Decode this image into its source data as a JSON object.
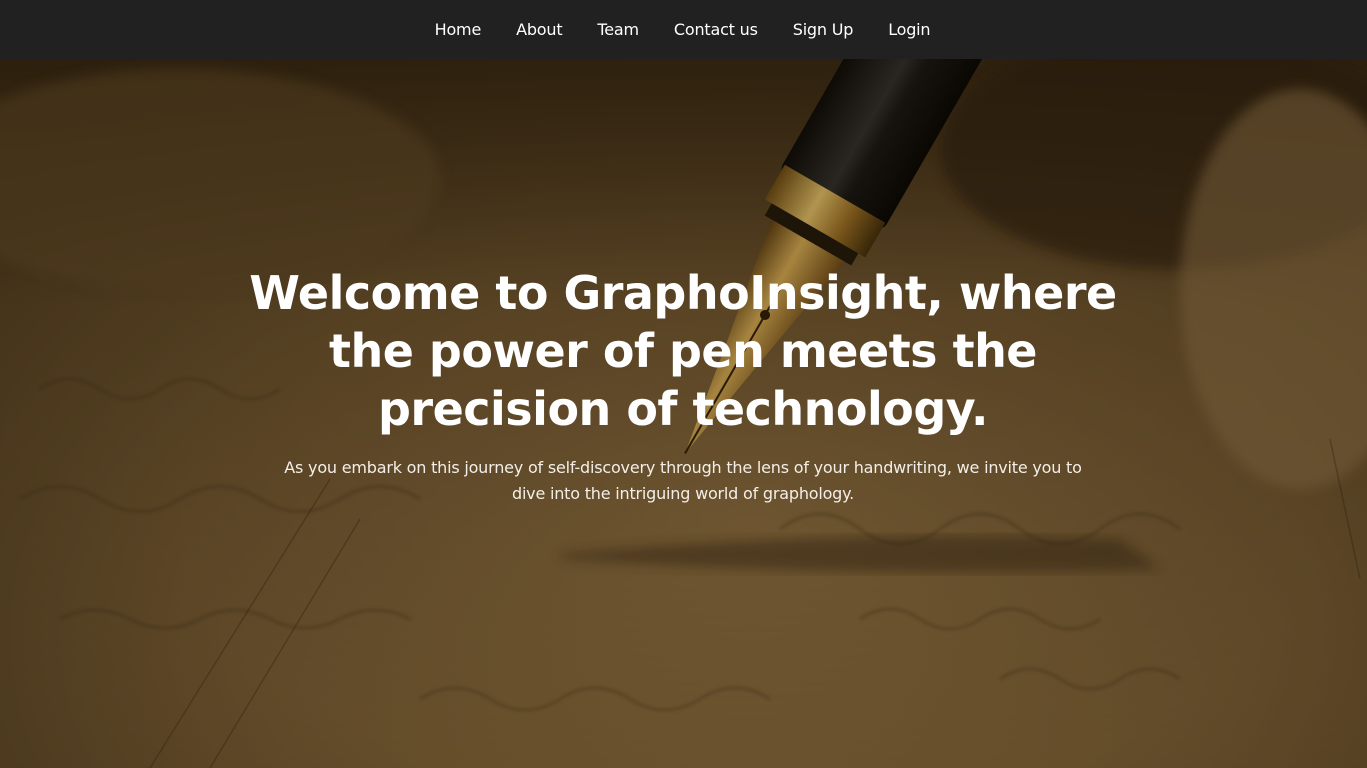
{
  "nav": {
    "items": [
      {
        "label": "Home"
      },
      {
        "label": "About"
      },
      {
        "label": "Team"
      },
      {
        "label": "Contact us"
      },
      {
        "label": "Sign Up"
      },
      {
        "label": "Login"
      }
    ]
  },
  "hero": {
    "title": "Welcome to GraphoInsight, where the power of pen meets the precision of technology.",
    "subtitle": "As you embark on this journey of self-discovery through the lens of your handwriting, we invite you to dive into the intriguing world of graphology."
  },
  "colors": {
    "navbar": "#212121",
    "nav_text": "#ffffff",
    "hero_text": "#ffffff",
    "hero_tint": "#6a5230"
  }
}
